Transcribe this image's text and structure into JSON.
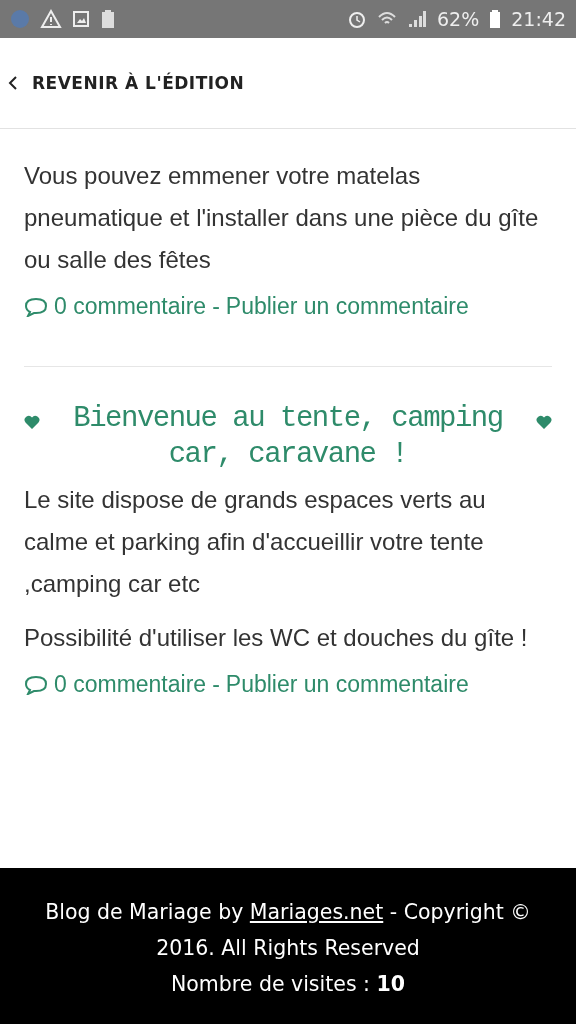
{
  "status_bar": {
    "battery": "62%",
    "time": "21:42"
  },
  "header": {
    "back_link": "REVENIR À L'ÉDITION"
  },
  "posts": [
    {
      "paragraphs": [
        "Vous pouvez emmener votre matelas pneumatique et l'installer dans une pièce du gîte ou salle des fêtes"
      ],
      "comments": {
        "count": "0 commentaire",
        "separator": "-",
        "publish": "Publier un commentaire"
      }
    },
    {
      "title": "Bienvenue au tente, camping car, caravane !",
      "paragraphs": [
        "Le site dispose de grands espaces verts au calme et parking afin d'accueillir votre tente ,camping car etc",
        "Possibilité d'utiliser les WC et douches du gîte !"
      ],
      "comments": {
        "count": "0 commentaire",
        "separator": "-",
        "publish": "Publier un commentaire"
      }
    }
  ],
  "footer": {
    "before_link": "Blog de Mariage by ",
    "link": "Mariages.net",
    "after_link": " - Copyright © 2016. All Rights Reserved",
    "visits": "Nombre de visites : **10**"
  }
}
